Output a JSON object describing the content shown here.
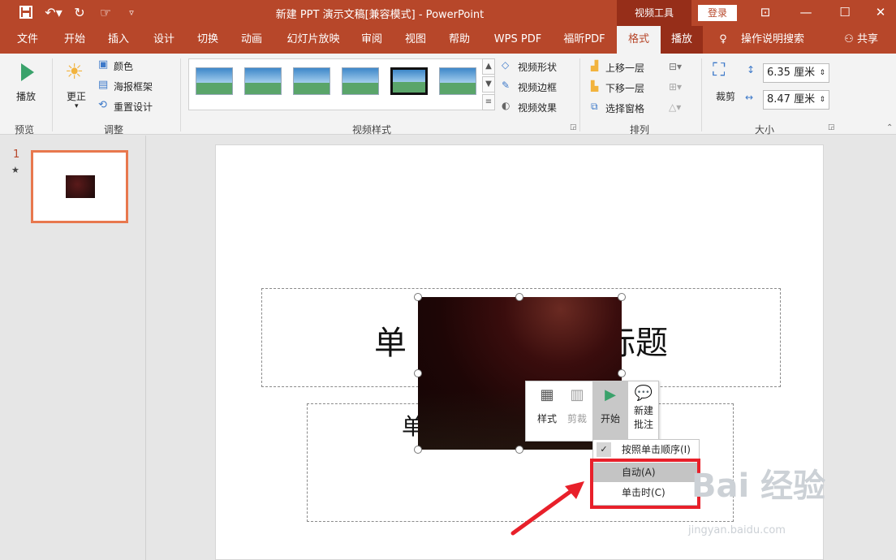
{
  "title": {
    "document": "新建 PPT 演示文稿[兼容模式] - PowerPoint",
    "context_tools": "视频工具",
    "login": "登录"
  },
  "tabs": [
    "文件",
    "开始",
    "插入",
    "设计",
    "切换",
    "动画",
    "幻灯片放映",
    "审阅",
    "视图",
    "帮助",
    "WPS PDF",
    "福昕PDF",
    "格式",
    "播放"
  ],
  "active_tab": "格式",
  "tell_me": "操作说明搜索",
  "share": "共享",
  "ribbon": {
    "preview": {
      "play": "播放",
      "group": "预览"
    },
    "adjust": {
      "correct": "更正",
      "color": "颜色",
      "poster_frame": "海报框架",
      "reset": "重置设计",
      "group": "调整"
    },
    "video_styles": {
      "shape": "视频形状",
      "border": "视频边框",
      "effects": "视频效果",
      "group": "视频样式"
    },
    "arrange": {
      "bring_forward": "上移一层",
      "send_backward": "下移一层",
      "selection_pane": "选择窗格",
      "group": "排列"
    },
    "size": {
      "crop": "裁剪",
      "height": "6.35 厘米",
      "width": "8.47 厘米",
      "group": "大小"
    }
  },
  "thumbnail": {
    "number": "1",
    "marker": "★"
  },
  "slide": {
    "title_visible": [
      "单",
      "标题"
    ],
    "subtitle_visible": "单"
  },
  "mini_toolbar": {
    "style": "样式",
    "trim": "剪裁",
    "start": "开始",
    "new_comment_line1": "新建",
    "new_comment_line2": "批注"
  },
  "start_menu": [
    "按照单击顺序(I)",
    "自动(A)",
    "单击时(C)"
  ],
  "watermark": {
    "text": "Bai 经验",
    "url": "jingyan.baidu.com"
  },
  "colors": {
    "accent": "#b7472a",
    "context": "#962e19",
    "highlight": "#e8202a"
  }
}
